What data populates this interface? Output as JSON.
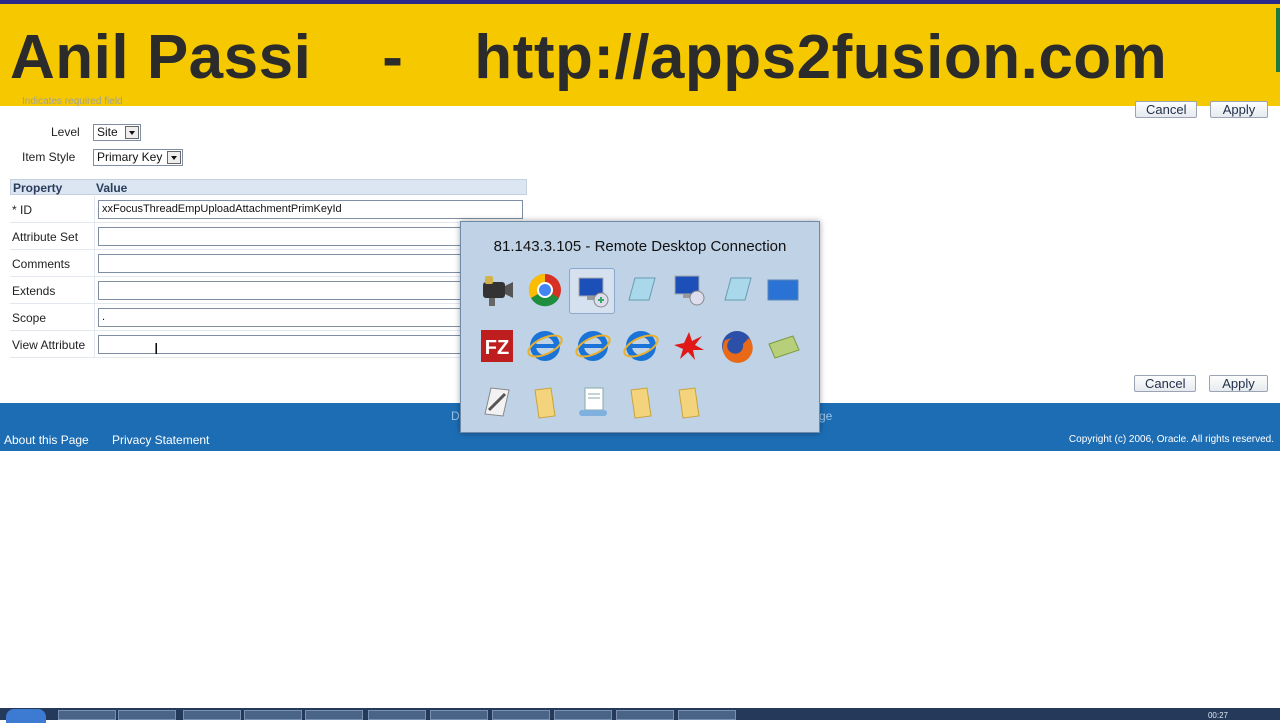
{
  "banner": {
    "text": "Anil Passi    -    http://apps2fusion.com"
  },
  "required_note": "Indicates required field",
  "top_buttons": {
    "cancel": "Cancel",
    "apply": "Apply"
  },
  "form": {
    "level_label": "Level",
    "level_value": "Site",
    "item_style_label": "Item Style",
    "item_style_value": "Primary Key"
  },
  "table": {
    "headers": [
      "Property",
      "Value"
    ],
    "rows": [
      {
        "label": "* ID",
        "value": "xxFocusThreadEmpUploadAttachmentPrimKeyId"
      },
      {
        "label": "Attribute Set",
        "value": ""
      },
      {
        "label": "Comments",
        "value": ""
      },
      {
        "label": "Extends",
        "value": ""
      },
      {
        "label": "Scope",
        "value": "."
      },
      {
        "label": "View Attribute",
        "value": ""
      }
    ]
  },
  "bottom_buttons": {
    "cancel": "Cancel",
    "apply": "Apply"
  },
  "footer": {
    "hidden_left": "D",
    "hidden_right": "ge",
    "about": "About this Page",
    "privacy": "Privacy Statement",
    "copyright": "Copyright (c) 2006, Oracle. All rights reserved."
  },
  "switcher": {
    "title": "81.143.3.105 - Remote Desktop Connection",
    "icons": [
      "camcorder-icon",
      "chrome-icon",
      "remote-desktop-icon",
      "notepad-icon",
      "remote-desktop-icon",
      "notepad-icon",
      "monitor-icon",
      "filezilla-icon",
      "internet-explorer-icon",
      "internet-explorer-icon",
      "internet-explorer-icon",
      "red-splat-icon",
      "firefox-icon",
      "stack-icon",
      "tools-icon",
      "folder-icon",
      "document-icon",
      "folder-icon",
      "folder-icon"
    ]
  },
  "taskbar": {
    "clock": "00:27"
  }
}
